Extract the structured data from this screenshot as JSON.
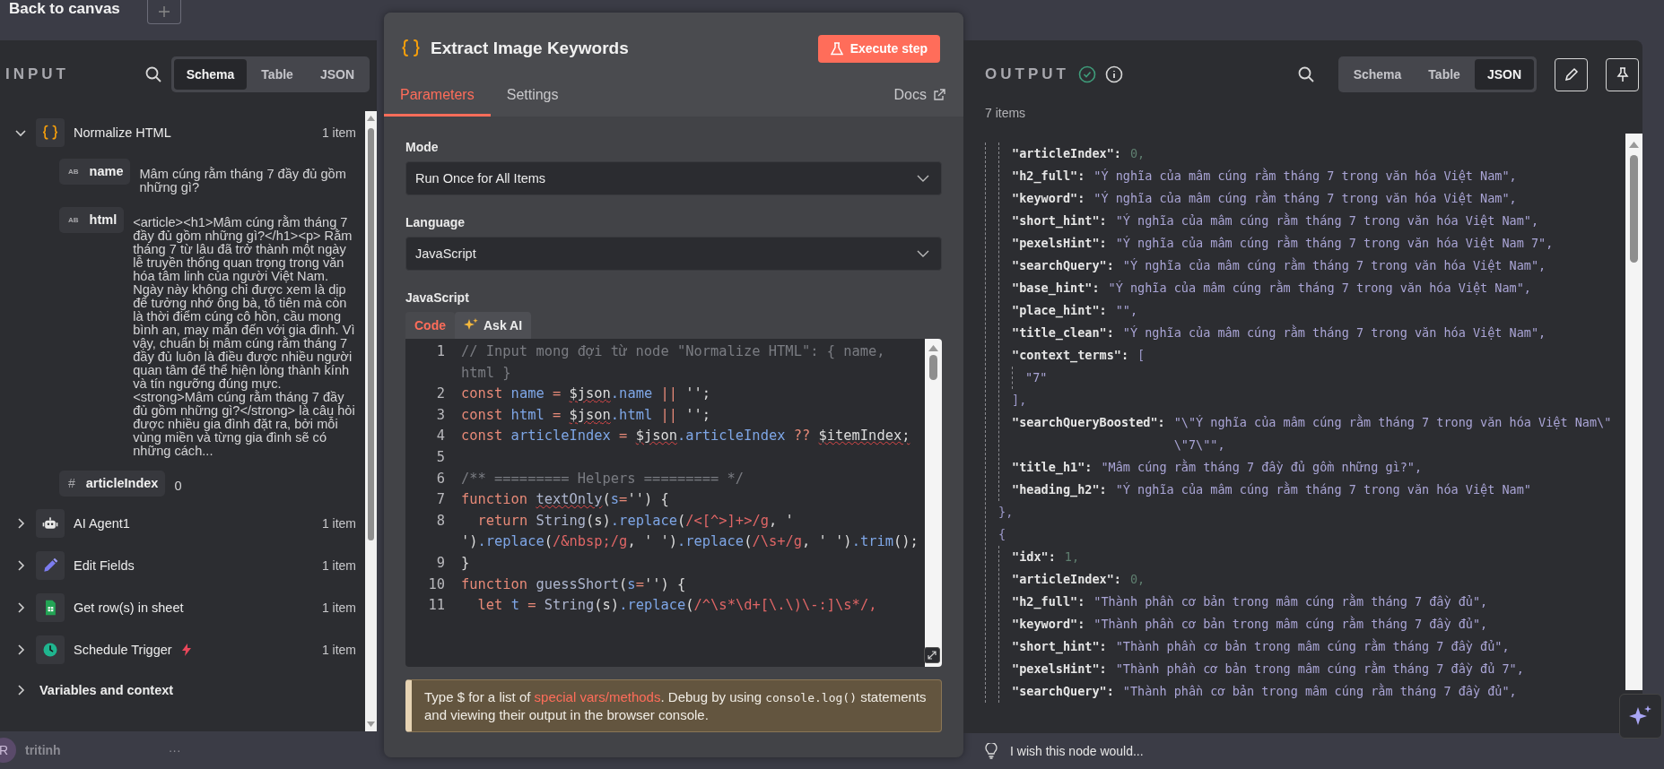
{
  "top_bar": {
    "back_label": "Back to canvas"
  },
  "input_panel": {
    "title": "INPUT",
    "view_tabs": [
      {
        "label": "Schema",
        "selected": true
      },
      {
        "label": "Table",
        "selected": false
      },
      {
        "label": "JSON",
        "selected": false
      }
    ],
    "nodes": [
      {
        "name": "Normalize HTML",
        "kind": "code",
        "count": "1 item",
        "expanded": true,
        "trigger": false,
        "fields": [
          {
            "type_label": "AB",
            "name": "name",
            "value": "Mâm cúng rằm tháng 7 đầy đủ gồm những gì?"
          },
          {
            "type_label": "AB",
            "name": "html",
            "value": "<article><h1>Mâm cúng rằm tháng 7 đầy đủ gồm những gì?</h1><p> Rằm tháng 7 từ lâu đã trở thành một ngày lễ truyền thống quan trọng trong văn hóa tâm linh của người Việt Nam. Ngày này không chỉ được xem là dịp để tưởng nhớ ông bà, tổ tiên mà còn là thời điểm cúng cô hồn, cầu mong bình an, may mắn đến với gia đình. Vì vậy, chuẩn bị mâm cúng rằm tháng 7 đầy đủ luôn là điều được nhiều người quan tâm để thể hiện lòng thành kính và tín ngưỡng đúng mực. <strong>Mâm cúng rằm tháng 7 đầy đủ gồm những gì?</strong> là câu hỏi được nhiều gia đình đặt ra, bởi mỗi vùng miền và từng gia đình sẽ có những cách..."
          },
          {
            "type_label": "#",
            "name": "articleIndex",
            "value": "0"
          }
        ]
      },
      {
        "name": "AI Agent1",
        "kind": "agent",
        "count": "1 item",
        "expanded": false,
        "trigger": false
      },
      {
        "name": "Edit Fields",
        "kind": "edit",
        "count": "1 item",
        "expanded": false,
        "trigger": false
      },
      {
        "name": "Get row(s) in sheet",
        "kind": "sheet",
        "count": "1 item",
        "expanded": false,
        "trigger": false
      },
      {
        "name": "Schedule Trigger",
        "kind": "schedule",
        "count": "1 item",
        "expanded": false,
        "trigger": true
      }
    ],
    "variables": {
      "label": "Variables and context",
      "expanded": false
    }
  },
  "user": {
    "initial": "R",
    "name": "tritinh",
    "menu": "···"
  },
  "node_panel": {
    "title": "Extract Image Keywords",
    "execute_button": "Execute step",
    "tabs": [
      {
        "label": "Parameters",
        "selected": true
      },
      {
        "label": "Settings",
        "selected": false
      }
    ],
    "docs_link": "Docs",
    "mode": {
      "label": "Mode",
      "value": "Run Once for All Items"
    },
    "language": {
      "label": "Language",
      "value": "JavaScript"
    },
    "editor_label": "JavaScript",
    "editor_tabs": [
      {
        "label": "Code",
        "selected": true
      },
      {
        "label": "Ask AI",
        "selected": false
      }
    ],
    "code_lines": [
      {
        "number": "1",
        "tokens": [
          {
            "text": "// Input mong đợi từ node \"Normalize HTML\": { name, html }",
            "kind": "comment"
          }
        ]
      },
      {
        "number": "2",
        "tokens": [
          {
            "text": "const ",
            "kind": "keyword"
          },
          {
            "text": "name",
            "kind": "variable"
          },
          {
            "text": " = ",
            "kind": "keyword"
          },
          {
            "text": "$json",
            "kind": "plain",
            "lint": true
          },
          {
            "text": ".name",
            "kind": "variable"
          },
          {
            "text": " || ",
            "kind": "keyword"
          },
          {
            "text": "'';",
            "kind": "plain"
          }
        ]
      },
      {
        "number": "3",
        "tokens": [
          {
            "text": "const ",
            "kind": "keyword"
          },
          {
            "text": "html",
            "kind": "variable"
          },
          {
            "text": " = ",
            "kind": "keyword"
          },
          {
            "text": "$json",
            "kind": "plain",
            "lint": true
          },
          {
            "text": ".html",
            "kind": "variable"
          },
          {
            "text": " || ",
            "kind": "keyword"
          },
          {
            "text": "'';",
            "kind": "plain"
          }
        ]
      },
      {
        "number": "4",
        "tokens": [
          {
            "text": "const ",
            "kind": "keyword"
          },
          {
            "text": "articleIndex",
            "kind": "variable"
          },
          {
            "text": " = ",
            "kind": "keyword"
          },
          {
            "text": "$json",
            "kind": "plain",
            "lint": true
          },
          {
            "text": ".articleIndex",
            "kind": "variable"
          },
          {
            "text": " ?? ",
            "kind": "keyword"
          },
          {
            "text": "$itemIndex;",
            "kind": "plain",
            "lint": true
          }
        ]
      },
      {
        "number": "5"
      },
      {
        "number": "6",
        "tokens": [
          {
            "text": "/** ========= Helpers ========= */",
            "kind": "comment"
          }
        ]
      },
      {
        "number": "7",
        "tokens": [
          {
            "text": "function ",
            "kind": "keyword"
          },
          {
            "text": "textOnly",
            "kind": "function",
            "lint": true
          },
          {
            "text": "(",
            "kind": "plain"
          },
          {
            "text": "s",
            "kind": "variable"
          },
          {
            "text": "=",
            "kind": "keyword"
          },
          {
            "text": "'') {",
            "kind": "plain"
          }
        ]
      },
      {
        "number": "8",
        "tokens": [
          {
            "text": "  return ",
            "kind": "keyword"
          },
          {
            "text": "String",
            "kind": "function"
          },
          {
            "text": "(s)",
            "kind": "plain"
          },
          {
            "text": ".replace",
            "kind": "variable"
          },
          {
            "text": "(",
            "kind": "plain"
          },
          {
            "text": "/<[^>]+>/g",
            "kind": "string"
          },
          {
            "text": ", ' ')",
            "kind": "plain"
          },
          {
            "text": ".replace",
            "kind": "variable"
          },
          {
            "text": "(",
            "kind": "plain"
          },
          {
            "text": "/&nbsp;/g",
            "kind": "string"
          },
          {
            "text": ", ' ')",
            "kind": "plain"
          },
          {
            "text": ".replace",
            "kind": "variable"
          },
          {
            "text": "(",
            "kind": "plain"
          },
          {
            "text": "/\\s+/g",
            "kind": "string"
          },
          {
            "text": ", ' ')",
            "kind": "plain"
          },
          {
            "text": ".trim",
            "kind": "variable"
          },
          {
            "text": "();",
            "kind": "plain"
          }
        ]
      },
      {
        "number": "9",
        "tokens": [
          {
            "text": "}",
            "kind": "plain"
          }
        ]
      },
      {
        "number": "10",
        "tokens": [
          {
            "text": "function ",
            "kind": "keyword"
          },
          {
            "text": "guessShort",
            "kind": "function"
          },
          {
            "text": "(",
            "kind": "plain"
          },
          {
            "text": "s",
            "kind": "variable"
          },
          {
            "text": "=",
            "kind": "keyword"
          },
          {
            "text": "'') {",
            "kind": "plain"
          }
        ]
      },
      {
        "number": "11",
        "tokens": [
          {
            "text": "  let ",
            "kind": "keyword"
          },
          {
            "text": "t",
            "kind": "variable"
          },
          {
            "text": " = ",
            "kind": "keyword"
          },
          {
            "text": "String",
            "kind": "function"
          },
          {
            "text": "(s)",
            "kind": "plain"
          },
          {
            "text": ".replace",
            "kind": "variable"
          },
          {
            "text": "(",
            "kind": "plain"
          },
          {
            "text": "/^\\s*\\d+[\\.\\)\\-:]\\s*/,",
            "kind": "string"
          }
        ]
      }
    ],
    "hint": [
      {
        "text": "Type $ for a list of ",
        "kind": "plain"
      },
      {
        "text": "special vars/methods",
        "kind": "link"
      },
      {
        "text": ". Debug by using ",
        "kind": "plain"
      },
      {
        "text": "console.log()",
        "kind": "code"
      },
      {
        "text": " statements and viewing their output in the browser console.",
        "kind": "plain"
      }
    ]
  },
  "output_panel": {
    "title": "OUTPUT",
    "view_tabs": [
      {
        "label": "Schema",
        "selected": false
      },
      {
        "label": "Table",
        "selected": false
      },
      {
        "label": "JSON",
        "selected": true
      }
    ],
    "item_count": "7 items",
    "items": [
      {
        "fields": [
          {
            "key": "\"articleIndex\":",
            "value": "0,",
            "kind": "number"
          },
          {
            "key": "\"h2_full\":",
            "value": "\"Ý nghĩa của mâm cúng rằm tháng 7 trong văn hóa Việt Nam\",",
            "kind": "string"
          },
          {
            "key": "\"keyword\":",
            "value": "\"Ý nghĩa của mâm cúng rằm tháng 7 trong văn hóa Việt Nam\",",
            "kind": "string"
          },
          {
            "key": "\"short_hint\":",
            "value": "\"Ý nghĩa của mâm cúng rằm tháng 7 trong văn hóa Việt Nam\",",
            "kind": "string"
          },
          {
            "key": "\"pexelsHint\":",
            "value": "\"Ý nghĩa của mâm cúng rằm tháng 7 trong văn hóa Việt Nam 7\",",
            "kind": "string"
          },
          {
            "key": "\"searchQuery\":",
            "value": "\"Ý nghĩa của mâm cúng rằm tháng 7 trong văn hóa Việt Nam\",",
            "kind": "string"
          },
          {
            "key": "\"base_hint\":",
            "value": "\"Ý nghĩa của mâm cúng rằm tháng 7 trong văn hóa Việt Nam\",",
            "kind": "string"
          },
          {
            "key": "\"place_hint\":",
            "value": "\"\",",
            "kind": "string"
          },
          {
            "key": "\"title_clean\":",
            "value": "\"Ý nghĩa của mâm cúng rằm tháng 7 trong văn hóa Việt Nam\",",
            "kind": "string"
          },
          {
            "key": "\"context_terms\":",
            "open": "[",
            "children": [
              {
                "value": "\"7\"",
                "kind": "string"
              }
            ],
            "close": "],"
          },
          {
            "key": "\"searchQueryBoosted\":",
            "value": "\"\\\"Ý nghĩa của mâm cúng rằm tháng 7 trong văn hóa Việt Nam\\\" \\\"7\\\"\",",
            "kind": "string"
          },
          {
            "key": "\"title_h1\":",
            "value": "\"Mâm cúng rằm tháng 7 đầy đủ gồm những gì?\",",
            "kind": "string"
          },
          {
            "key": "\"heading_h2\":",
            "value": "\"Ý nghĩa của mâm cúng rằm tháng 7 trong văn hóa Việt Nam\"",
            "kind": "string"
          }
        ],
        "close": "},"
      },
      {
        "open": "{",
        "fields": [
          {
            "key": "\"idx\":",
            "value": "1,",
            "kind": "number"
          },
          {
            "key": "\"articleIndex\":",
            "value": "0,",
            "kind": "number"
          },
          {
            "key": "\"h2_full\":",
            "value": "\"Thành phần cơ bản trong mâm cúng rằm tháng 7 đầy đủ\",",
            "kind": "string"
          },
          {
            "key": "\"keyword\":",
            "value": "\"Thành phần cơ bản trong mâm cúng rằm tháng 7 đầy đủ\",",
            "kind": "string"
          },
          {
            "key": "\"short_hint\":",
            "value": "\"Thành phần cơ bản trong mâm cúng rằm tháng 7 đầy đủ\",",
            "kind": "string"
          },
          {
            "key": "\"pexelsHint\":",
            "value": "\"Thành phần cơ bản trong mâm cúng rằm tháng 7 đầy đủ 7\",",
            "kind": "string"
          },
          {
            "key": "\"searchQuery\":",
            "value": "\"Thành phần cơ bản trong mâm cúng rằm tháng 7 đầy đủ\",",
            "kind": "string"
          }
        ]
      }
    ]
  },
  "feedback_prompt": "I wish this node would..."
}
